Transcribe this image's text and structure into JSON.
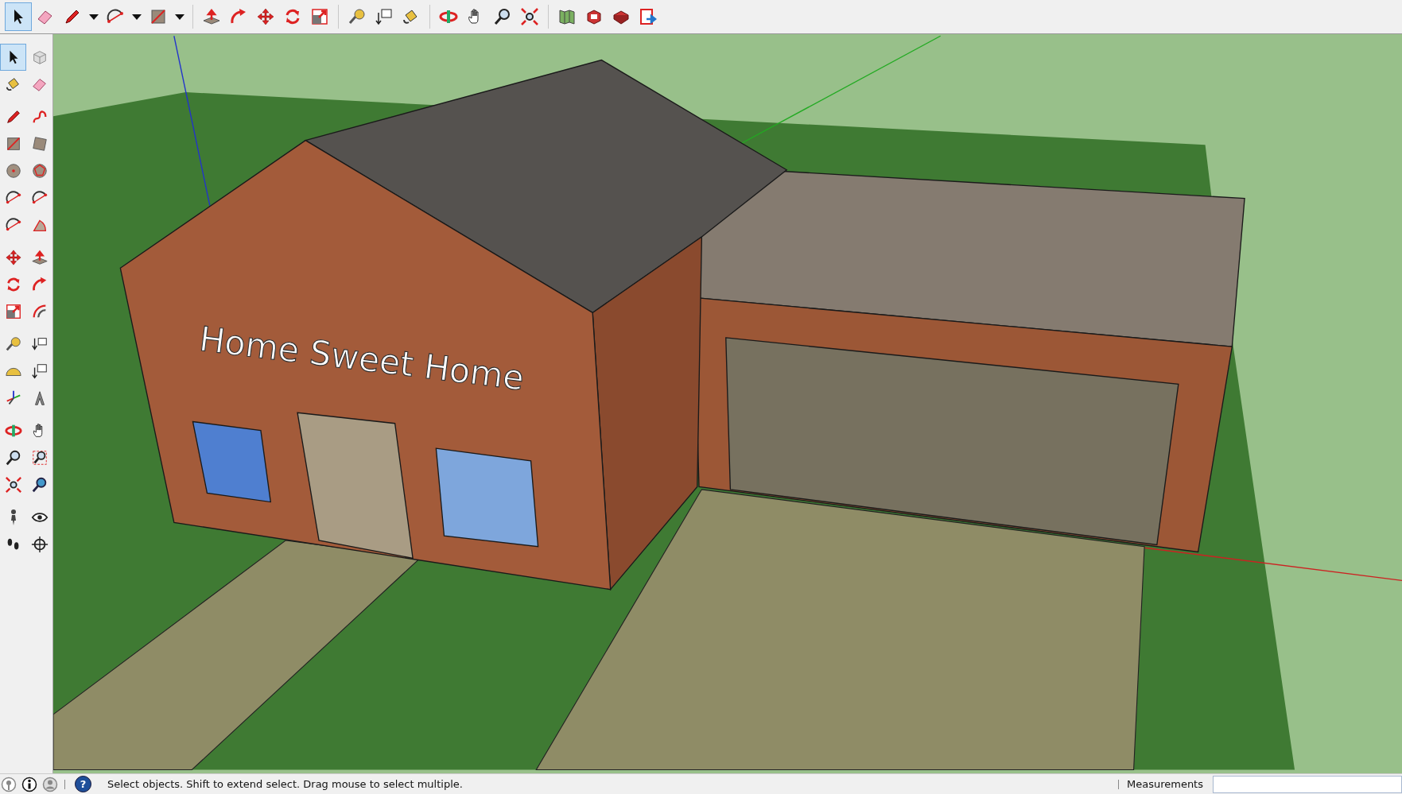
{
  "top_toolbar": {
    "groups": [
      [
        {
          "kind": "tool",
          "selected": true
        },
        {
          "kind": "tool",
          "selected": false
        },
        {
          "kind": "tool",
          "selected": false
        },
        {
          "kind": "menu"
        },
        {
          "kind": "tool",
          "selected": false
        },
        {
          "kind": "menu"
        },
        {
          "kind": "tool",
          "selected": false
        },
        {
          "kind": "menu"
        }
      ],
      [
        {
          "kind": "tool",
          "selected": false
        },
        {
          "kind": "tool",
          "selected": false
        },
        {
          "kind": "tool",
          "selected": false
        },
        {
          "kind": "tool",
          "selected": false
        },
        {
          "kind": "tool",
          "selected": false
        }
      ],
      [
        {
          "kind": "tool",
          "selected": false
        },
        {
          "kind": "tool",
          "selected": false
        },
        {
          "kind": "tool",
          "selected": false
        }
      ],
      [
        {
          "kind": "tool",
          "selected": false
        },
        {
          "kind": "tool",
          "selected": false
        },
        {
          "kind": "tool",
          "selected": false
        },
        {
          "kind": "tool",
          "selected": false
        }
      ],
      [
        {
          "kind": "tool",
          "selected": false
        },
        {
          "kind": "tool",
          "selected": false
        },
        {
          "kind": "tool",
          "selected": false
        },
        {
          "kind": "tool",
          "selected": false
        }
      ]
    ]
  },
  "left_toolbar": {
    "groups": [
      [
        {
          "selected": true
        },
        {
          "selected": false
        },
        {
          "selected": false
        },
        {
          "selected": false
        }
      ],
      [
        {
          "selected": false
        },
        {
          "selected": false
        },
        {
          "selected": false
        },
        {
          "selected": false
        },
        {
          "selected": false
        },
        {
          "selected": false
        },
        {
          "selected": false
        },
        {
          "selected": false
        },
        {
          "selected": false
        },
        {
          "selected": false
        }
      ],
      [
        {
          "selected": false
        },
        {
          "selected": false
        },
        {
          "selected": false
        },
        {
          "selected": false
        },
        {
          "selected": false
        },
        {
          "selected": false
        }
      ],
      [
        {
          "selected": false
        },
        {
          "selected": false
        },
        {
          "selected": false
        },
        {
          "selected": false
        },
        {
          "selected": false
        },
        {
          "selected": false
        }
      ],
      [
        {
          "selected": false
        },
        {
          "selected": false
        },
        {
          "selected": false
        },
        {
          "selected": false
        },
        {
          "selected": false
        },
        {
          "selected": false
        }
      ],
      [
        {
          "selected": false
        },
        {
          "selected": false
        },
        {
          "selected": false
        },
        {
          "selected": false
        }
      ]
    ]
  },
  "viewport": {
    "model_text": "Home Sweet Home"
  },
  "status_bar": {
    "help_icon": "?",
    "message": "Select objects. Shift to extend select. Drag mouse to select multiple.",
    "measurements_label": "Measurements"
  }
}
